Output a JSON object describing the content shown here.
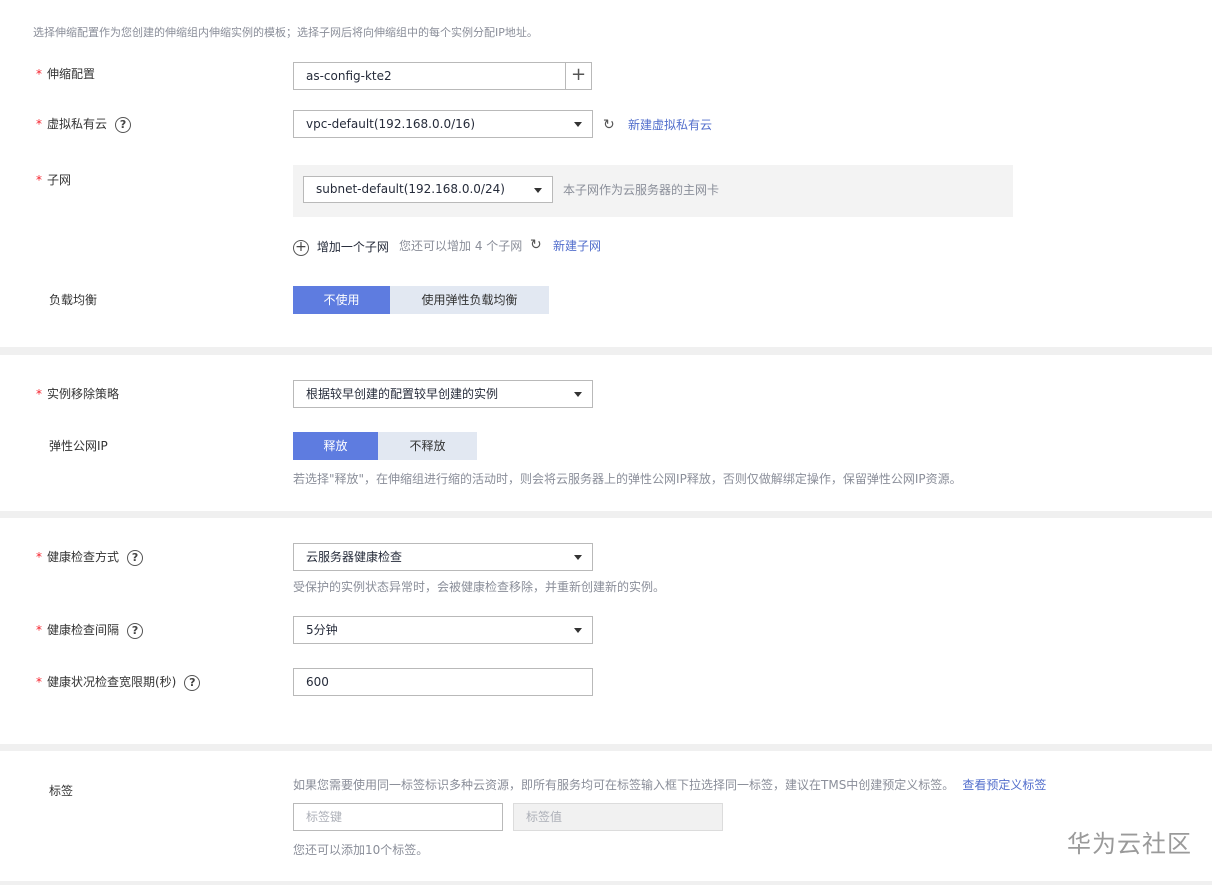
{
  "intro": "选择伸缩配置作为您创建的伸缩组内伸缩实例的模板；选择子网后将向伸缩组中的每个实例分配IP地址。",
  "config": {
    "label": "伸缩配置",
    "value": "as-config-kte2",
    "add": "+"
  },
  "vpc": {
    "label": "虚拟私有云",
    "help": "?",
    "value": "vpc-default(192.168.0.0/16)",
    "refresh": "↻",
    "create_link": "新建虚拟私有云"
  },
  "subnet": {
    "label": "子网",
    "value": "subnet-default(192.168.0.0/24)",
    "hint": "本子网作为云服务器的主网卡",
    "add_icon": "+",
    "add_label": "增加一个子网",
    "add_hint": "您还可以增加 4 个子网",
    "refresh": "↻",
    "create_link": "新建子网"
  },
  "lb": {
    "label": "负载均衡",
    "options": [
      "不使用",
      "使用弹性负载均衡"
    ],
    "selected": 0
  },
  "removal": {
    "label": "实例移除策略",
    "value": "根据较早创建的配置较早创建的实例"
  },
  "eip": {
    "label": "弹性公网IP",
    "options": [
      "释放",
      "不释放"
    ],
    "selected": 0,
    "hint": "若选择\"释放\"，在伸缩组进行缩的活动时，则会将云服务器上的弹性公网IP释放，否则仅做解绑定操作，保留弹性公网IP资源。"
  },
  "health_method": {
    "label": "健康检查方式",
    "help": "?",
    "value": "云服务器健康检查",
    "hint": "受保护的实例状态异常时，会被健康检查移除，并重新创建新的实例。"
  },
  "health_interval": {
    "label": "健康检查间隔",
    "help": "?",
    "value": "5分钟"
  },
  "grace": {
    "label": "健康状况检查宽限期(秒)",
    "help": "?",
    "value": "600"
  },
  "tags": {
    "label": "标签",
    "hint": "如果您需要使用同一标签标识多种云资源，即所有服务均可在标签输入框下拉选择同一标签，建议在TMS中创建预定义标签。",
    "link": "查看预定义标签",
    "key_placeholder": "标签键",
    "value_placeholder": "标签值",
    "note": "您还可以添加10个标签。"
  },
  "required_mark": "*",
  "watermark": "华为云社区",
  "colors": {
    "primary": "#5e7ce0",
    "link": "#526ecc",
    "required": "#f5222d",
    "segment_off": "#e2e8f2"
  }
}
